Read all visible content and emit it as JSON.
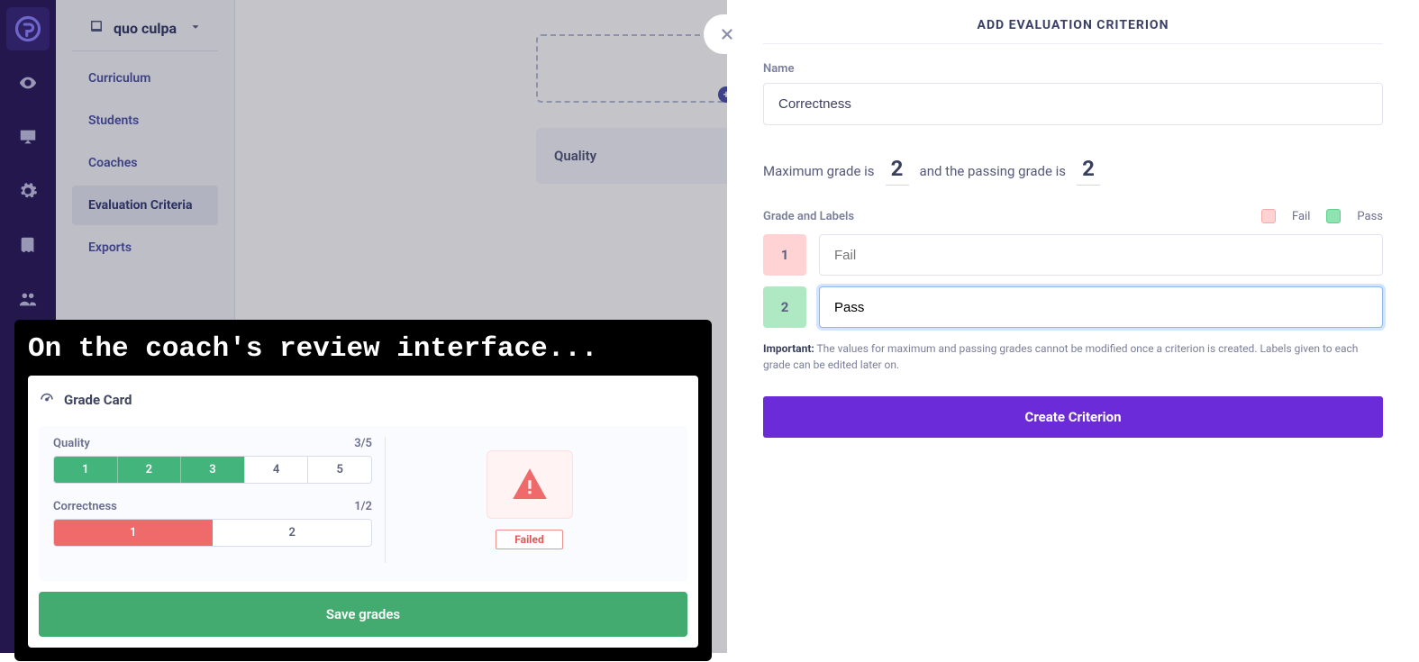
{
  "course": {
    "title": "quo culpa"
  },
  "sidebar": {
    "items": [
      {
        "label": "Curriculum"
      },
      {
        "label": "Students"
      },
      {
        "label": "Coaches"
      },
      {
        "label": "Evaluation Criteria",
        "active": true
      },
      {
        "label": "Exports"
      }
    ]
  },
  "main": {
    "quality_card": "Quality"
  },
  "tour": {
    "title": "On the coach's review interface...",
    "card_title": "Grade Card",
    "quality": {
      "label": "Quality",
      "score": "3/5",
      "buttons": [
        "1",
        "2",
        "3",
        "4",
        "5"
      ]
    },
    "correctness": {
      "label": "Correctness",
      "score": "1/2",
      "buttons": [
        "1",
        "2"
      ]
    },
    "failed": "Failed",
    "save": "Save grades"
  },
  "panel": {
    "title": "ADD EVALUATION CRITERION",
    "name_label": "Name",
    "name_value": "Correctness",
    "max_text_a": "Maximum grade is",
    "max_value": "2",
    "max_text_b": "and the passing grade is",
    "pass_value": "2",
    "grade_labels_label": "Grade and Labels",
    "legend_fail": "Fail",
    "legend_pass": "Pass",
    "grades": [
      {
        "n": "1",
        "cls": "num-fail",
        "ph": "Fail",
        "val": "",
        "focus": false
      },
      {
        "n": "2",
        "cls": "num-pass",
        "ph": "Pass",
        "val": "Pass",
        "focus": true
      }
    ],
    "note_strong": "Important:",
    "note_text": " The values for maximum and passing grades cannot be modified once a criterion is created. Labels given to each grade can be edited later on.",
    "submit": "Create Criterion"
  }
}
